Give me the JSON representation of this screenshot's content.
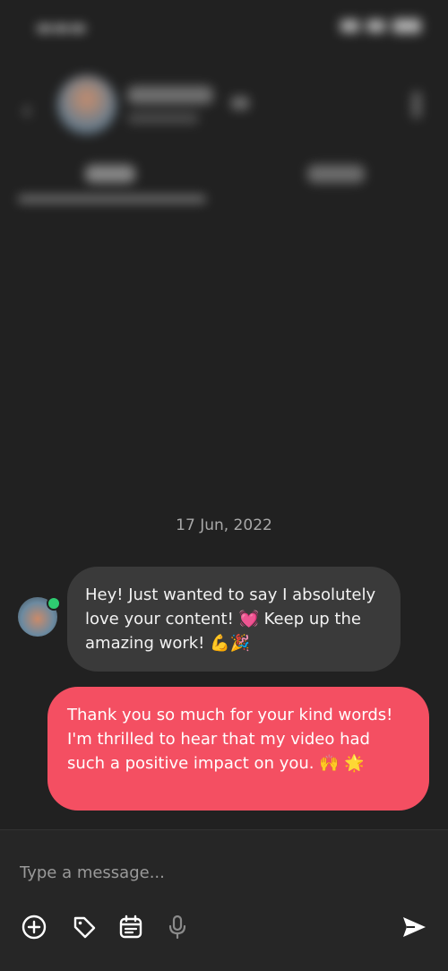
{
  "chat": {
    "date_divider": "17 Jun, 2022",
    "messages": [
      {
        "direction": "incoming",
        "text": "Hey! Just wanted to say I absolutely love your content! 💓 Keep up the amazing work! 💪🎉"
      },
      {
        "direction": "outgoing",
        "text": "Thank you so much for your kind words! I'm thrilled to hear that my video had such a positive impact on you. 🙌 🌟"
      }
    ]
  },
  "composer": {
    "placeholder": "Type a message...",
    "value": ""
  },
  "icons": {
    "add": "plus-circle-icon",
    "tag": "tag-icon",
    "calendar": "calendar-icon",
    "mic": "microphone-icon",
    "send": "send-icon",
    "back": "back-arrow-icon",
    "more": "more-vertical-icon"
  },
  "colors": {
    "background": "#212121",
    "incoming_bubble": "#3a3a3a",
    "outgoing_bubble": "#f44f62",
    "online": "#2ecc71"
  }
}
